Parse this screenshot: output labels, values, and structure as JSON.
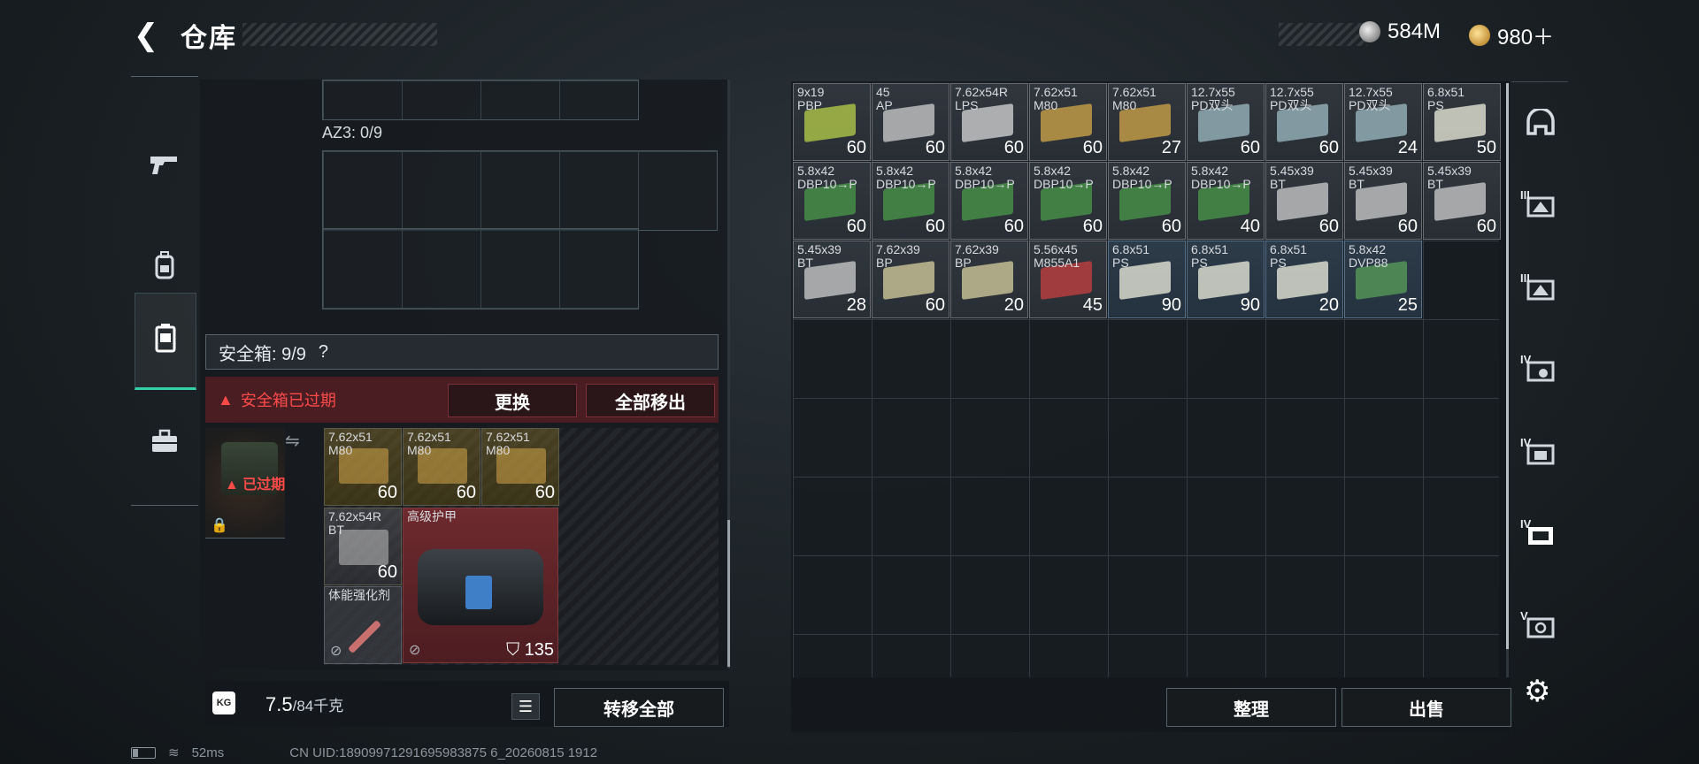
{
  "header": {
    "title": "仓库",
    "back_icon": "arrow-back-icon",
    "currency": [
      {
        "icon": "silver-coin-icon",
        "value": "584M"
      },
      {
        "icon": "gold-coin-icon",
        "value": "980＋"
      }
    ]
  },
  "left_tabs": [
    {
      "icon": "pistol-icon",
      "active": false
    },
    {
      "icon": "backpack-icon",
      "active": false
    },
    {
      "icon": "safe-box-icon",
      "active": true
    },
    {
      "icon": "toolbox-icon",
      "active": false
    }
  ],
  "container": {
    "az3_label": "AZ3: 0/9"
  },
  "safe_box": {
    "header": "安全箱: 9/9",
    "help": "?",
    "expired_warning": "安全箱已过期",
    "replace_label": "更换",
    "remove_all_label": "全部移出",
    "expired_overlay": "已过期",
    "items": [
      {
        "name": "7.62x51\nM80",
        "count": "60",
        "style": "yellow"
      },
      {
        "name": "7.62x51\nM80",
        "count": "60",
        "style": "yellow"
      },
      {
        "name": "7.62x51\nM80",
        "count": "60",
        "style": "yellow"
      },
      {
        "name": "7.62x54R\nBT",
        "count": "60",
        "style": "white"
      },
      {
        "name": "高级护甲",
        "count": "135",
        "style": "red"
      },
      {
        "name": "体能强化剂",
        "count": "",
        "style": "plain"
      }
    ]
  },
  "footer_left": {
    "weight_value": "7.5",
    "weight_max": "/84千克",
    "kg_badge": "KG",
    "transfer_all_label": "转移全部"
  },
  "storage_items": [
    {
      "name": "9x19\nPBP",
      "count": "60",
      "crate": "#b8d04a"
    },
    {
      "name": "45\nAP",
      "count": "60",
      "crate": "#cfcfcf"
    },
    {
      "name": "7.62x54R\nLPS",
      "count": "60",
      "crate": "#d8d8d8"
    },
    {
      "name": "7.62x51\nM80",
      "count": "60",
      "crate": "#d3a84a"
    },
    {
      "name": "7.62x51\nM80",
      "count": "27",
      "crate": "#d3a84a"
    },
    {
      "name": "12.7x55\nPD双头",
      "count": "60",
      "crate": "#9fbcc4"
    },
    {
      "name": "12.7x55\nPD双头",
      "count": "60",
      "crate": "#9fbcc4"
    },
    {
      "name": "12.7x55\nPD双头",
      "count": "24",
      "crate": "#9fbcc4"
    },
    {
      "name": "6.8x51\nPS",
      "count": "50",
      "crate": "#f0f0e0"
    },
    {
      "name": "5.8x42\nDBP10→P",
      "count": "60",
      "crate": "#4a9a4a"
    },
    {
      "name": "5.8x42\nDBP10→P",
      "count": "60",
      "crate": "#4a9a4a"
    },
    {
      "name": "5.8x42\nDBP10→P",
      "count": "60",
      "crate": "#4a9a4a"
    },
    {
      "name": "5.8x42\nDBP10→P",
      "count": "60",
      "crate": "#4a9a4a"
    },
    {
      "name": "5.8x42\nDBP10→P",
      "count": "60",
      "crate": "#4a9a4a"
    },
    {
      "name": "5.8x42\nDBP10→P",
      "count": "40",
      "crate": "#4a9a4a"
    },
    {
      "name": "5.45x39\nBT",
      "count": "60",
      "crate": "#cfcfcf"
    },
    {
      "name": "5.45x39\nBT",
      "count": "60",
      "crate": "#cfcfcf"
    },
    {
      "name": "5.45x39\nBT",
      "count": "60",
      "crate": "#cfcfcf"
    },
    {
      "name": "5.45x39\nBT",
      "count": "28",
      "crate": "#cfcfcf"
    },
    {
      "name": "7.62x39\nBP",
      "count": "60",
      "crate": "#d8d0a0"
    },
    {
      "name": "7.62x39\nBP",
      "count": "20",
      "crate": "#d8d0a0"
    },
    {
      "name": "5.56x45\nM855A1",
      "count": "45",
      "crate": "#c84040"
    },
    {
      "name": "6.8x51\nPS",
      "count": "90",
      "crate": "#f0f0e0"
    },
    {
      "name": "6.8x51\nPS",
      "count": "90",
      "crate": "#f0f0e0"
    },
    {
      "name": "6.8x51\nPS",
      "count": "20",
      "crate": "#f0f0e0"
    },
    {
      "name": "5.8x42\nDVP88",
      "count": "25",
      "crate": "#5aa05a"
    }
  ],
  "footer_right": {
    "sort_label": "整理",
    "sell_label": "出售"
  },
  "right_tabs": [
    {
      "icon": "helmet-icon",
      "level": ""
    },
    {
      "icon": "ammo-crate-icon",
      "level": "III"
    },
    {
      "icon": "ammo-crate-icon",
      "level": "III"
    },
    {
      "icon": "ammo-crate-icon",
      "level": "IV"
    },
    {
      "icon": "ammo-crate-icon",
      "level": "IV"
    },
    {
      "icon": "ammo-crate-icon",
      "level": "IV"
    },
    {
      "icon": "ammo-crate-icon",
      "level": "V"
    }
  ],
  "status_bar": {
    "ping": "52ms",
    "uid": "CN UID:18909971291695983875 6_20260815 1912"
  }
}
